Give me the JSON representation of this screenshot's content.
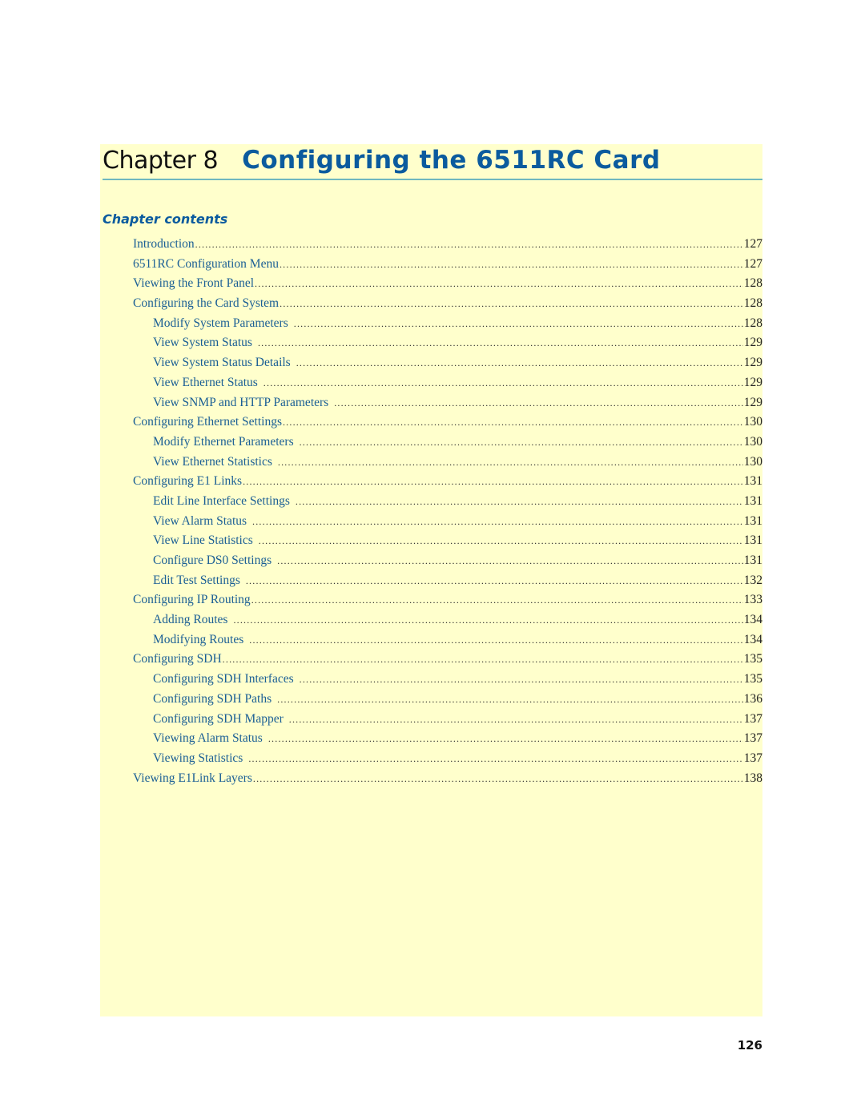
{
  "chapter": {
    "label": "Chapter 8",
    "title": "Configuring the 6511RC Card"
  },
  "contents_heading": "Chapter contents",
  "toc": [
    {
      "title": "Introduction",
      "page": "127",
      "level": 1
    },
    {
      "title": "6511RC Configuration Menu",
      "page": "127",
      "level": 1
    },
    {
      "title": "Viewing the Front Panel",
      "page": "128",
      "level": 1
    },
    {
      "title": "Configuring the Card System",
      "page": "128",
      "level": 1
    },
    {
      "title": "Modify System Parameters",
      "page": "128",
      "level": 2
    },
    {
      "title": "View System Status",
      "page": "129",
      "level": 2
    },
    {
      "title": "View System Status Details",
      "page": "129",
      "level": 2
    },
    {
      "title": "View Ethernet Status",
      "page": "129",
      "level": 2
    },
    {
      "title": "View SNMP and HTTP Parameters",
      "page": "129",
      "level": 2
    },
    {
      "title": "Configuring Ethernet Settings",
      "page": "130",
      "level": 1
    },
    {
      "title": "Modify Ethernet Parameters",
      "page": "130",
      "level": 2
    },
    {
      "title": "View Ethernet Statistics",
      "page": "130",
      "level": 2
    },
    {
      "title": "Configuring E1 Links",
      "page": "131",
      "level": 1
    },
    {
      "title": "Edit Line Interface Settings",
      "page": "131",
      "level": 2
    },
    {
      "title": "View Alarm Status",
      "page": "131",
      "level": 2
    },
    {
      "title": "View Line Statistics",
      "page": "131",
      "level": 2
    },
    {
      "title": "Configure DS0 Settings",
      "page": "131",
      "level": 2
    },
    {
      "title": "Edit Test Settings",
      "page": "132",
      "level": 2
    },
    {
      "title": "Configuring IP Routing",
      "page": "133",
      "level": 1
    },
    {
      "title": "Adding Routes",
      "page": "134",
      "level": 2
    },
    {
      "title": "Modifying Routes",
      "page": "134",
      "level": 2
    },
    {
      "title": "Configuring SDH",
      "page": "135",
      "level": 1
    },
    {
      "title": "Configuring SDH Interfaces",
      "page": "135",
      "level": 2
    },
    {
      "title": "Configuring SDH Paths",
      "page": "136",
      "level": 2
    },
    {
      "title": "Configuring SDH Mapper",
      "page": "137",
      "level": 2
    },
    {
      "title": "Viewing Alarm Status",
      "page": "137",
      "level": 2
    },
    {
      "title": "Viewing Statistics",
      "page": "137",
      "level": 2
    },
    {
      "title": "Viewing E1Link Layers",
      "page": "138",
      "level": 1
    }
  ],
  "page_number": "126",
  "colors": {
    "panel_background": "#ffffcc",
    "title_blue": "#0b5b9e",
    "toc_text": "#1b5f95",
    "rule": "#6fb8bf"
  }
}
